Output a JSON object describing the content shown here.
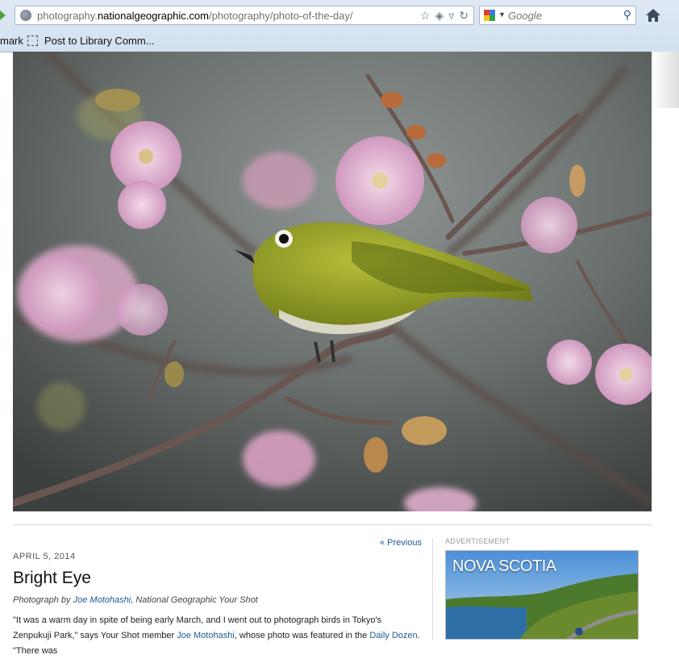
{
  "browser": {
    "url_prefix": "photography.",
    "url_domain": "nationalgeographic.com",
    "url_path": "/photography/photo-of-the-day/",
    "search_placeholder": "Google",
    "bookmark_1": "mark",
    "bookmark_2": "Post to Library Comm...",
    "icons": [
      "globe-icon",
      "star-icon",
      "pocket-icon",
      "dropdown-icon",
      "reload-icon",
      "google-icon",
      "search-icon",
      "home-icon"
    ]
  },
  "article": {
    "previous_link": "« Previous",
    "date": "APRIL 5, 2014",
    "title": "Bright Eye",
    "credit_prefix": "Photograph by ",
    "credit_author": "Joe Motohashi",
    "credit_suffix": ", National Geographic Your Shot",
    "body_1": "\"It was a warm day in spite of being early March, and I went out to photograph birds in Tokyo's Zenpukuji Park,\" says Your Shot member ",
    "body_author": "Joe Motohashi",
    "body_2": ", whose photo was featured in the ",
    "body_link": "Daily Dozen",
    "body_3": ". \"There was"
  },
  "ad": {
    "label": "ADVERTISEMENT",
    "brand": "NOVA SCOTIA"
  },
  "colors": {
    "link": "#1f5895",
    "chrome": "#d2e0f0"
  }
}
